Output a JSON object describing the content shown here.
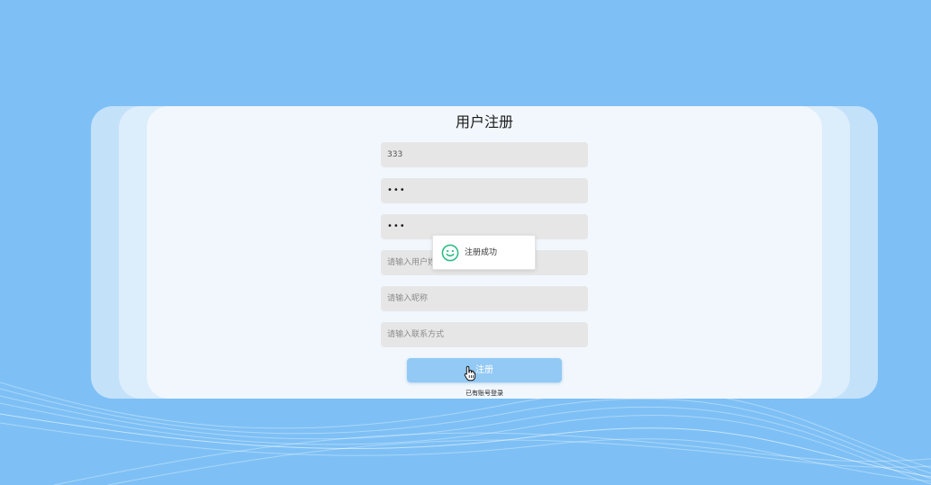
{
  "page": {
    "title": "用户注册"
  },
  "form": {
    "username_value": "333",
    "password_value": "•••",
    "confirm_password_value": "•••",
    "realname_placeholder": "请输入用户姓名",
    "nickname_placeholder": "请输入昵称",
    "contact_placeholder": "请输入联系方式",
    "register_label": "注册",
    "login_link": "已有账号登录"
  },
  "toast": {
    "message": "注册成功",
    "icon": "smile-icon"
  },
  "colors": {
    "background": "#7ec0f5",
    "panel": "#f1f7fd",
    "button": "#92c9f5",
    "success": "#2ebd85"
  }
}
